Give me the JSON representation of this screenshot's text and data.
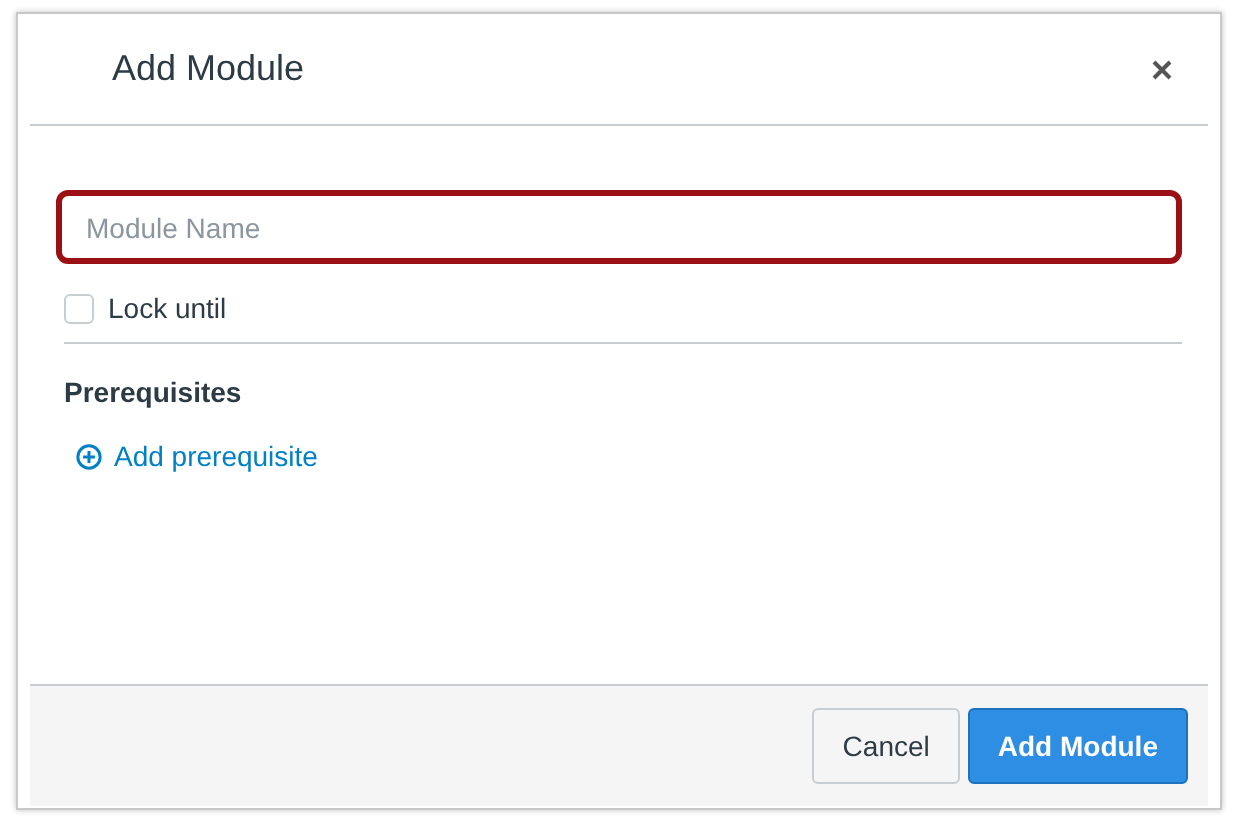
{
  "dialog": {
    "title": "Add Module"
  },
  "module_name": {
    "placeholder": "Module Name",
    "focused": true
  },
  "lock_until": {
    "label": "Lock until",
    "checked": false
  },
  "prerequisites": {
    "heading": "Prerequisites",
    "add_link": "Add prerequisite"
  },
  "buttons": [
    {
      "label": "Cancel",
      "kind": "secondary"
    },
    {
      "label": "Add Module",
      "kind": "primary"
    }
  ]
}
